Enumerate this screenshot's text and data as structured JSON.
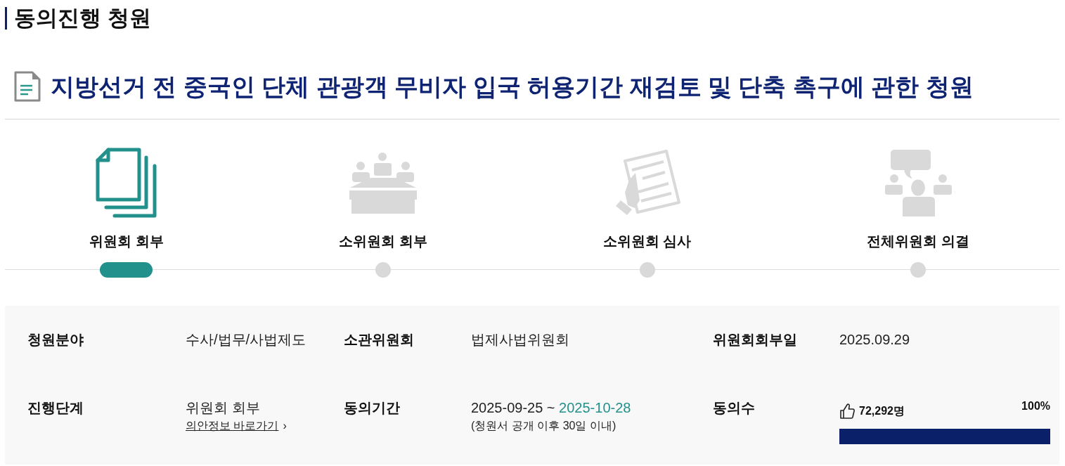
{
  "page_title": "동의진행 청원",
  "petition_title": "지방선거 전 중국인 단체 관광객 무비자 입국 허용기간 재검토 및 단축 촉구에 관한 청원",
  "steps": [
    {
      "label": "위원회 회부",
      "selected": true
    },
    {
      "label": "소위원회 회부",
      "selected": false
    },
    {
      "label": "소위원회 심사",
      "selected": false
    },
    {
      "label": "전체위원회 의결",
      "selected": false
    }
  ],
  "details": [
    {
      "kind": "text",
      "label": "청원분야",
      "value": "수사/법무/사법제도"
    },
    {
      "kind": "text",
      "label": "소관위원회",
      "value": "법제사법위원회"
    },
    {
      "kind": "text",
      "label": "위원회회부일",
      "value": "2025.09.29"
    },
    {
      "kind": "link",
      "label": "진행단계",
      "value": "위원회 회부",
      "link": "의안정보 바로가기",
      "link_arrow": "›"
    },
    {
      "kind": "period",
      "label": "동의기간",
      "start": "2025-09-25",
      "separator": "~",
      "end": "2025-10-28",
      "note": "(청원서 공개 이후 30일 이내)"
    },
    {
      "kind": "progress",
      "label": "동의수",
      "count": "72,292명",
      "percent": "100%",
      "level": 1
    }
  ]
}
